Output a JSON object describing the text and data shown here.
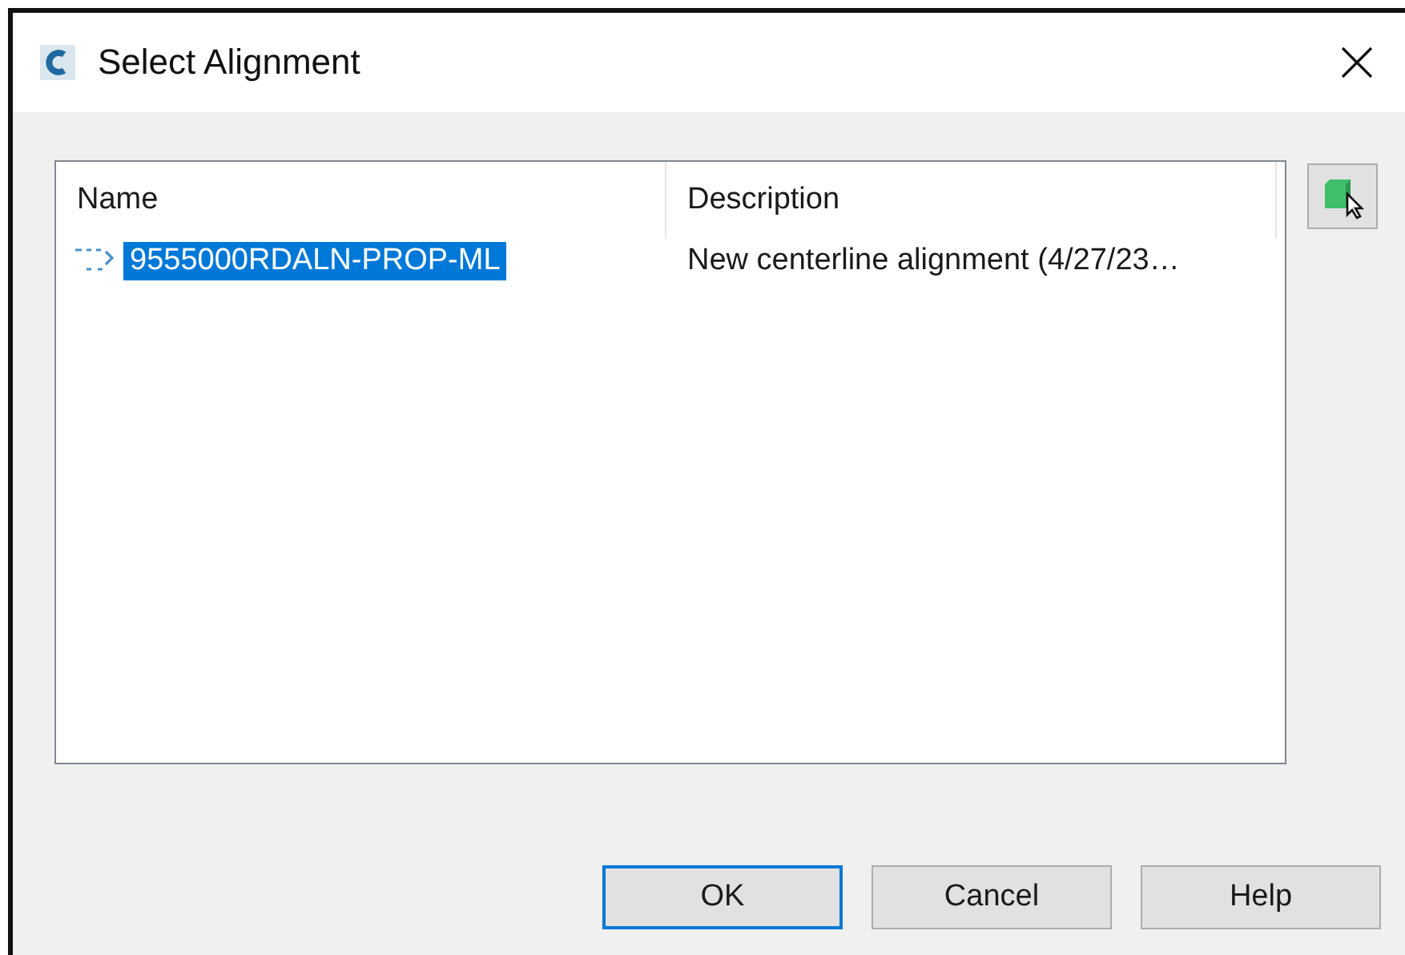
{
  "window": {
    "title": "Select Alignment"
  },
  "table": {
    "columns": [
      "Name",
      "Description"
    ],
    "rows": [
      {
        "name": "9555000RDALN-PROP-ML",
        "description": "New centerline alignment (4/27/23…",
        "selected": true
      }
    ]
  },
  "buttons": [
    {
      "label": "OK",
      "default": true
    },
    {
      "label": "Cancel",
      "default": false
    },
    {
      "label": "Help",
      "default": false
    }
  ]
}
